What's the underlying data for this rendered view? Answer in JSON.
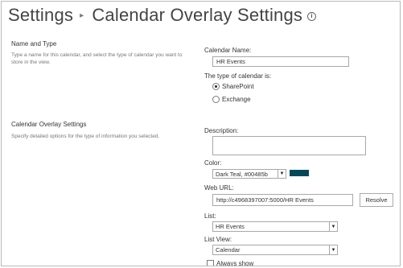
{
  "header": {
    "breadcrumb_root": "Settings",
    "separator": "▸",
    "page_title": "Calendar Overlay Settings",
    "info_glyph": "i"
  },
  "name_type_section": {
    "title": "Name and Type",
    "description": "Type a name for this calendar, and select the type of calendar you want to store in the view."
  },
  "overlay_section": {
    "title": "Calendar Overlay Settings",
    "description": "Specify detailed options for the type of information you selected."
  },
  "fields": {
    "calendar_name_label": "Calendar Name:",
    "calendar_name_value": "HR Events",
    "calendar_type_label": "The type of calendar is:",
    "calendar_type_options": [
      {
        "label": "SharePoint",
        "selected": true
      },
      {
        "label": "Exchange",
        "selected": false
      }
    ],
    "description_label": "Description:",
    "description_value": "",
    "color_label": "Color:",
    "color_value": "Dark Teal, #00485b",
    "color_swatch": "#00485b",
    "web_url_label": "Web URL:",
    "web_url_value": "http://c4968397007:5000/HR Events",
    "resolve_button": "Resolve",
    "list_label": "List:",
    "list_value": "HR Events",
    "list_view_label": "List View:",
    "list_view_value": "Calendar",
    "always_show_label": "Always show"
  },
  "icons": {
    "dropdown_arrow": "▼"
  }
}
